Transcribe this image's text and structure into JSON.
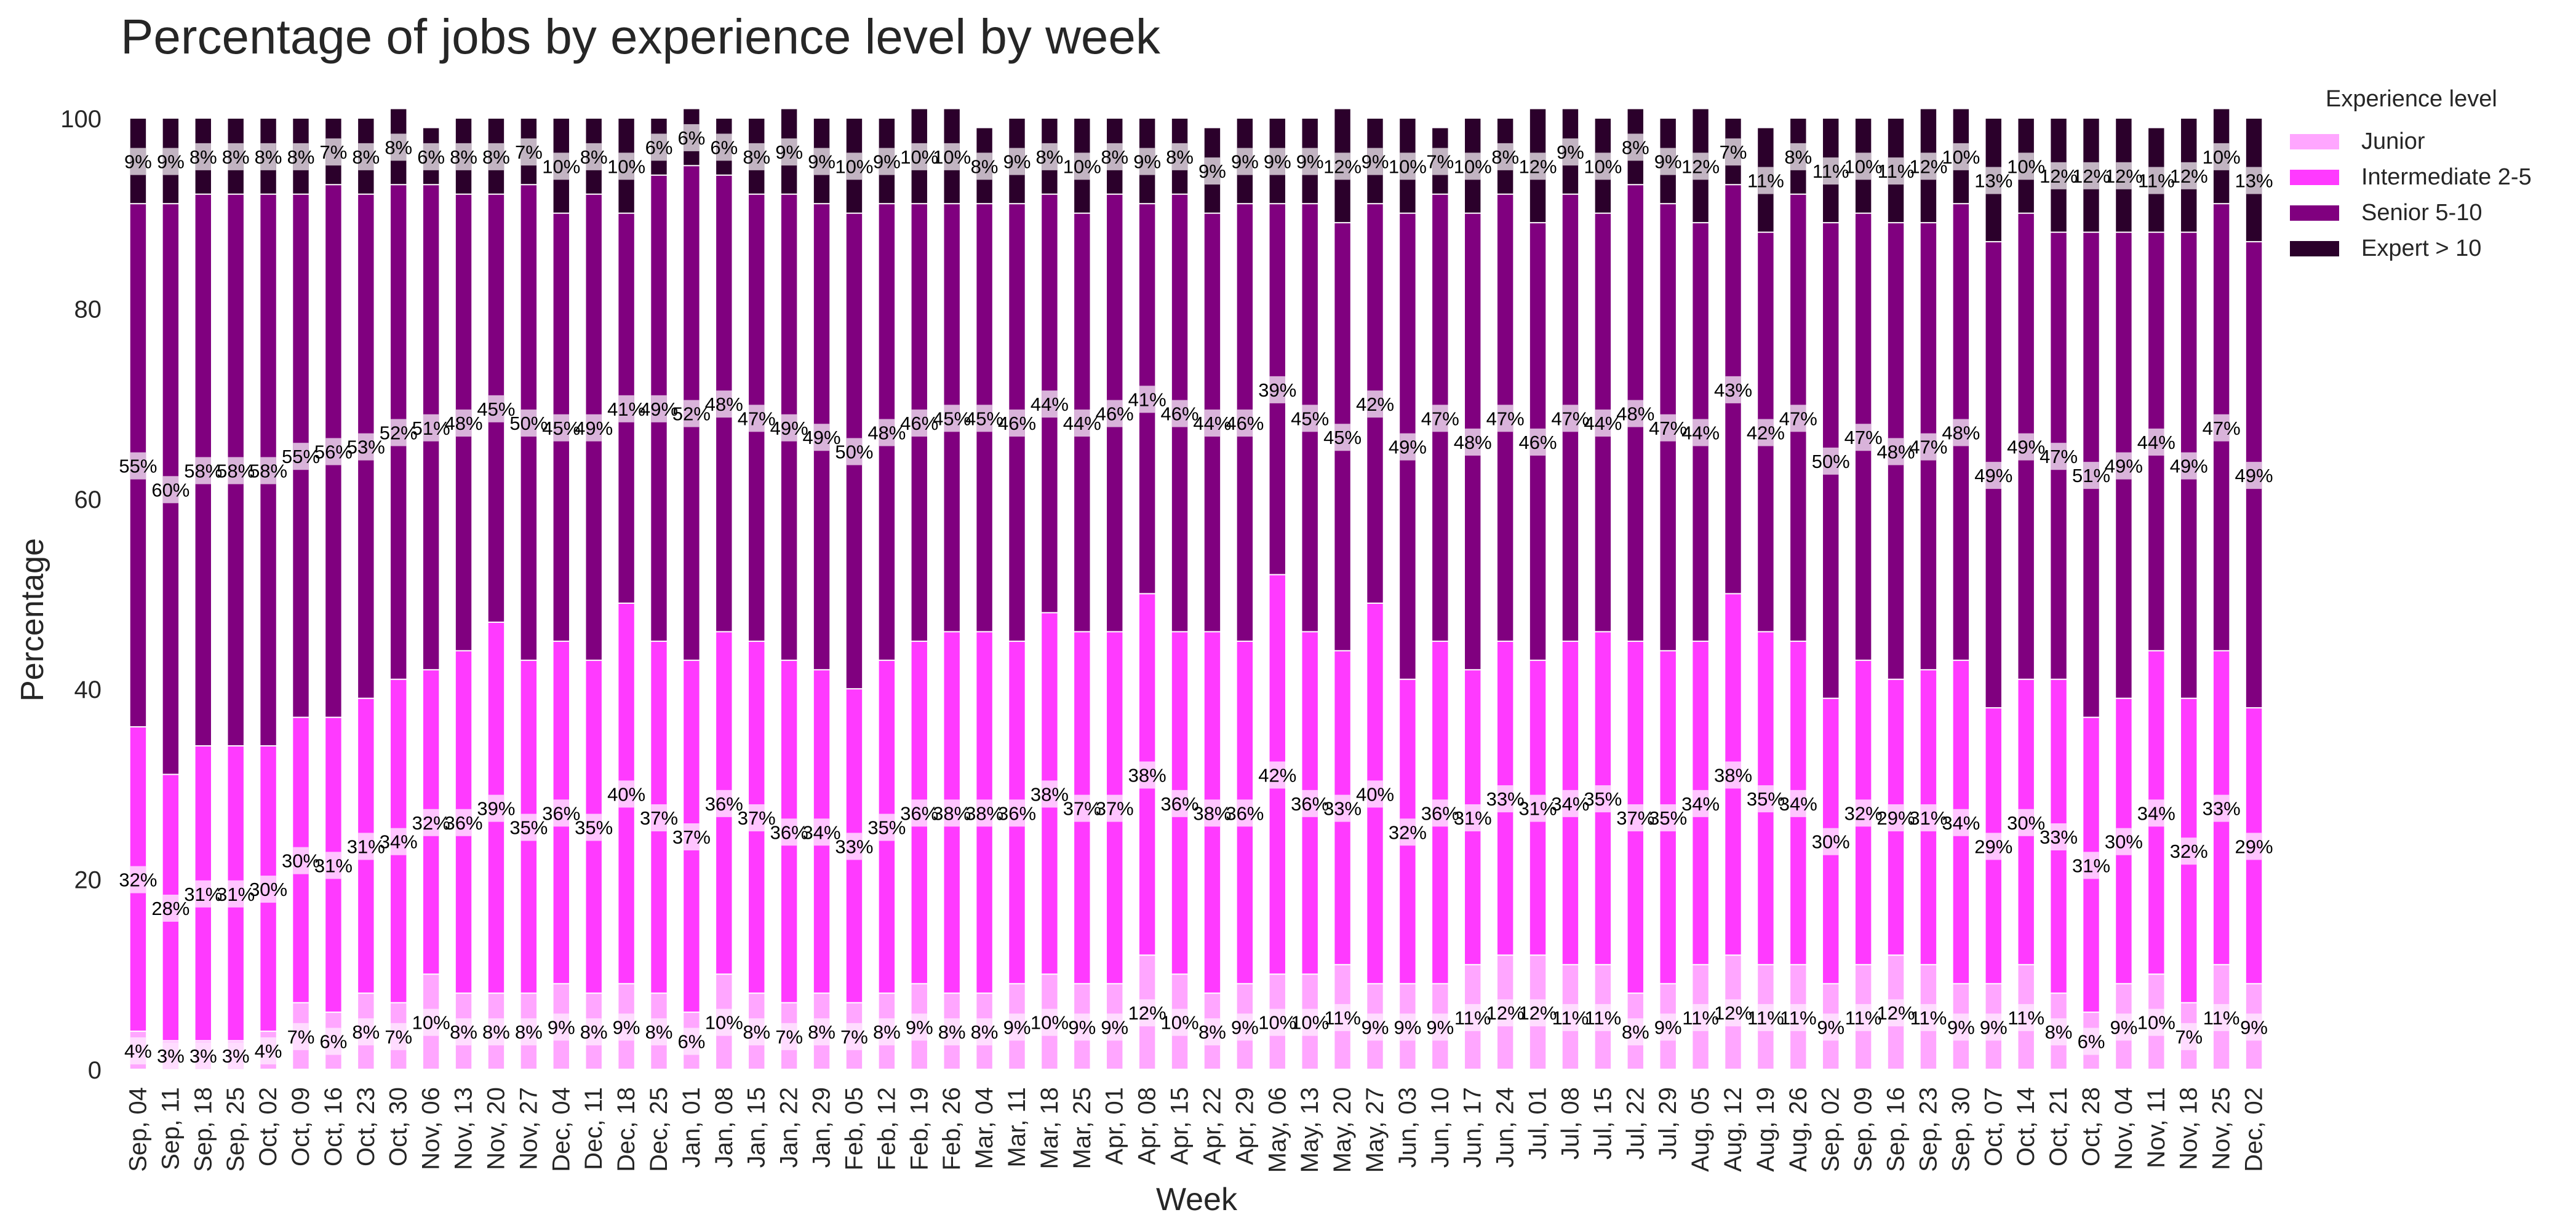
{
  "chart_data": {
    "type": "bar",
    "stacked": true,
    "title": "Percentage of jobs by experience level by week",
    "xlabel": "Week",
    "ylabel": "Percentage",
    "ylim": [
      0,
      100
    ],
    "yticks": [
      0,
      20,
      40,
      60,
      80,
      100
    ],
    "grid": false,
    "legend": {
      "title": "Experience level",
      "placement": "top-right-outside"
    },
    "categories": [
      "Sep, 04",
      "Sep, 11",
      "Sep, 18",
      "Sep, 25",
      "Oct, 02",
      "Oct, 09",
      "Oct, 16",
      "Oct, 23",
      "Oct, 30",
      "Nov, 06",
      "Nov, 13",
      "Nov, 20",
      "Nov, 27",
      "Dec, 04",
      "Dec, 11",
      "Dec, 18",
      "Dec, 25",
      "Jan, 01",
      "Jan, 08",
      "Jan, 15",
      "Jan, 22",
      "Jan, 29",
      "Feb, 05",
      "Feb, 12",
      "Feb, 19",
      "Feb, 26",
      "Mar, 04",
      "Mar, 11",
      "Mar, 18",
      "Mar, 25",
      "Apr, 01",
      "Apr, 08",
      "Apr, 15",
      "Apr, 22",
      "Apr, 29",
      "May, 06",
      "May, 13",
      "May, 20",
      "May, 27",
      "Jun, 03",
      "Jun, 10",
      "Jun, 17",
      "Jun, 24",
      "Jul, 01",
      "Jul, 08",
      "Jul, 15",
      "Jul, 22",
      "Jul, 29",
      "Aug, 05",
      "Aug, 12",
      "Aug, 19",
      "Aug, 26",
      "Sep, 02",
      "Sep, 09",
      "Sep, 16",
      "Sep, 23",
      "Sep, 30",
      "Oct, 07",
      "Oct, 14",
      "Oct, 21",
      "Oct, 28",
      "Nov, 04",
      "Nov, 11",
      "Nov, 18",
      "Nov, 25",
      "Dec, 02"
    ],
    "series": [
      {
        "name": "Junior",
        "color": "#ffa6ff",
        "label_bg": "#ffdcff",
        "values": [
          4,
          3,
          3,
          3,
          4,
          7,
          6,
          8,
          7,
          10,
          8,
          8,
          8,
          9,
          8,
          9,
          8,
          6,
          10,
          8,
          7,
          8,
          7,
          8,
          9,
          8,
          8,
          9,
          10,
          9,
          9,
          12,
          10,
          8,
          9,
          10,
          10,
          11,
          9,
          9,
          9,
          11,
          12,
          12,
          11,
          11,
          8,
          9,
          11,
          12,
          11,
          11,
          9,
          11,
          12,
          11,
          9,
          9,
          11,
          8,
          6,
          9,
          10,
          7,
          11,
          9
        ]
      },
      {
        "name": "Intermediate 2-5",
        "color": "#ff3aff",
        "label_bg": "#ffc4ff",
        "values": [
          32,
          28,
          31,
          31,
          30,
          30,
          31,
          31,
          34,
          32,
          36,
          39,
          35,
          36,
          35,
          40,
          37,
          37,
          36,
          37,
          36,
          34,
          33,
          35,
          36,
          38,
          38,
          36,
          38,
          37,
          37,
          38,
          36,
          38,
          36,
          42,
          36,
          33,
          40,
          32,
          36,
          31,
          33,
          31,
          34,
          35,
          37,
          35,
          34,
          38,
          35,
          34,
          30,
          32,
          29,
          31,
          34,
          29,
          30,
          33,
          31,
          30,
          34,
          32,
          33,
          29
        ]
      },
      {
        "name": "Senior 5-10",
        "color": "#80007f",
        "label_bg": "#d9b3da",
        "values": [
          55,
          60,
          58,
          58,
          58,
          55,
          56,
          53,
          52,
          51,
          48,
          45,
          50,
          45,
          49,
          41,
          49,
          52,
          48,
          47,
          49,
          49,
          50,
          48,
          46,
          45,
          45,
          46,
          44,
          44,
          46,
          41,
          46,
          44,
          46,
          39,
          45,
          45,
          42,
          49,
          47,
          48,
          47,
          46,
          47,
          44,
          48,
          47,
          44,
          43,
          42,
          47,
          50,
          47,
          48,
          47,
          48,
          49,
          49,
          47,
          51,
          49,
          44,
          49,
          47,
          49
        ]
      },
      {
        "name": "Expert > 10",
        "color": "#2b002b",
        "label_bg": "#c2b4c2",
        "values": [
          9,
          9,
          8,
          8,
          8,
          8,
          7,
          8,
          8,
          6,
          8,
          8,
          7,
          10,
          8,
          10,
          6,
          6,
          6,
          8,
          9,
          9,
          10,
          9,
          10,
          10,
          8,
          9,
          8,
          10,
          8,
          9,
          8,
          9,
          9,
          9,
          9,
          12,
          9,
          10,
          7,
          10,
          8,
          12,
          9,
          10,
          8,
          9,
          12,
          7,
          11,
          8,
          11,
          10,
          11,
          12,
          10,
          13,
          10,
          12,
          12,
          12,
          11,
          12,
          10,
          13
        ]
      }
    ]
  }
}
